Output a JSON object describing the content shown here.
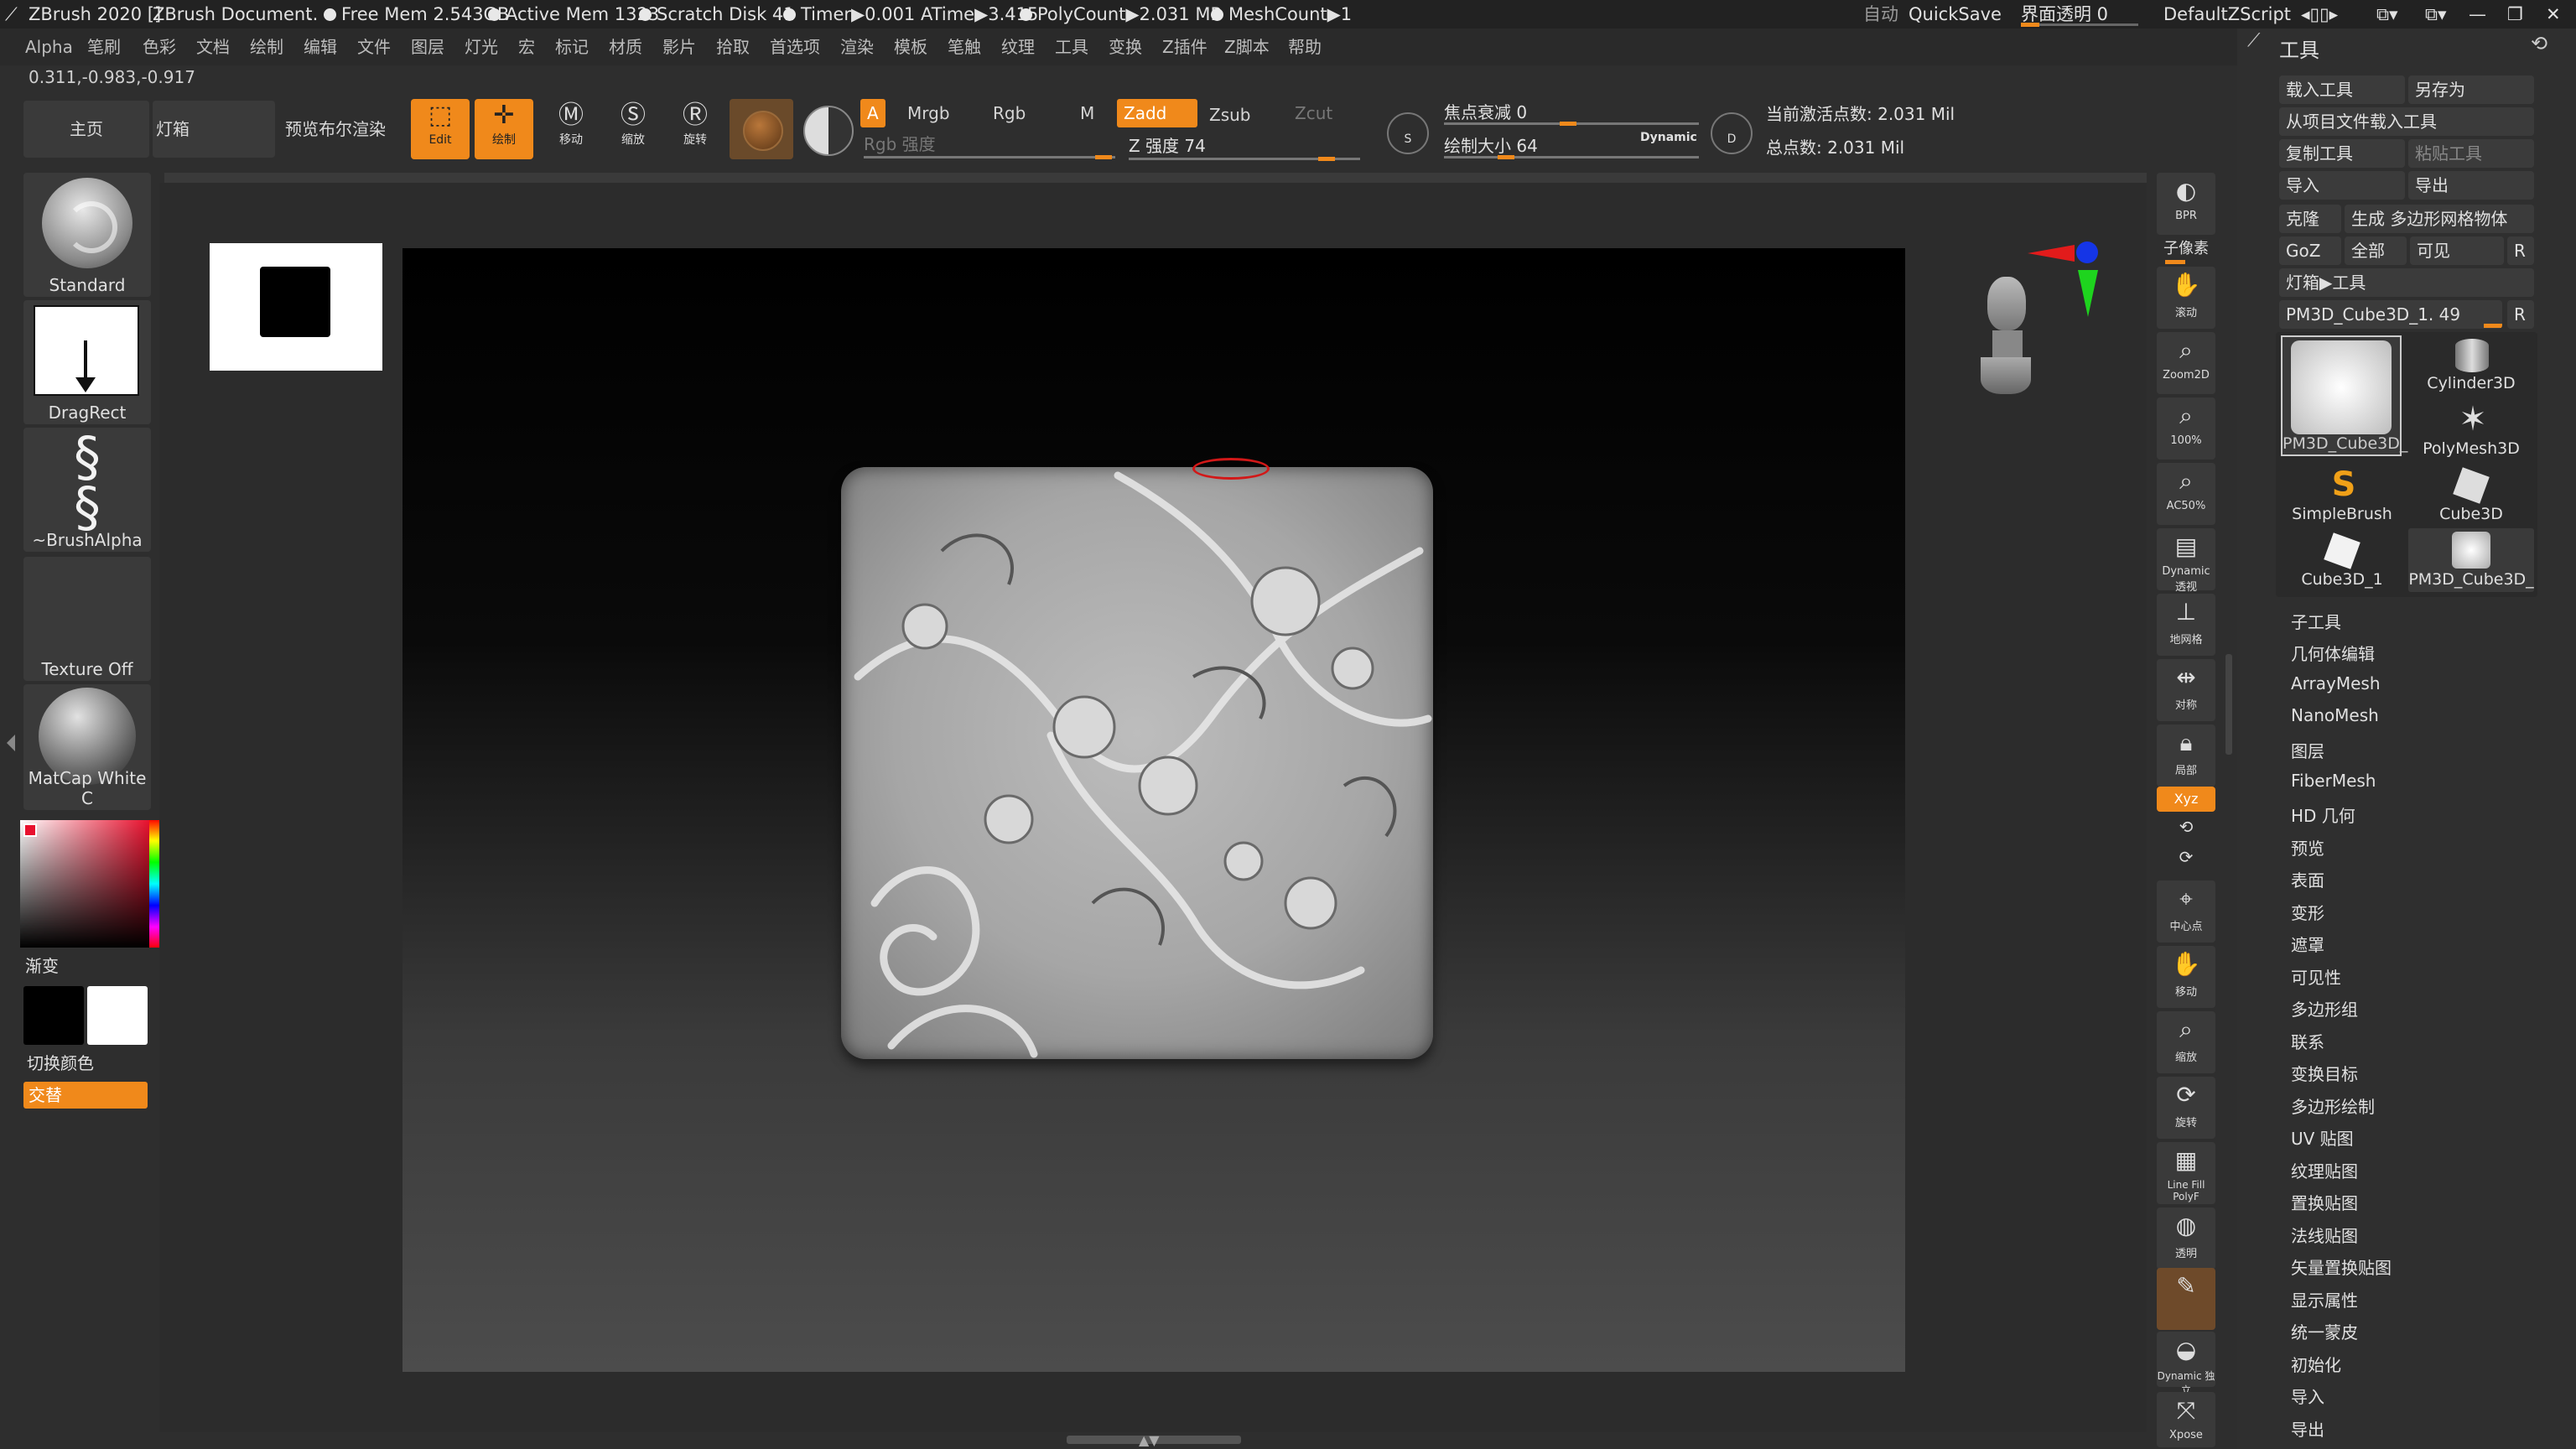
{
  "titlebar": {
    "app": "ZBrush 2020 []",
    "document": "ZBrush Document",
    "free_mem": "Free Mem 2.543GB",
    "active_mem": "Active Mem 1323",
    "scratch_disk": "Scratch Disk 41",
    "timer": "Timer▶0.001 ATime▶3.415",
    "polycount": "PolyCount▶2.031 MP",
    "meshcount": "MeshCount▶1",
    "auto": "自动",
    "quicksave": "QuickSave",
    "transparency": "界面透明 0",
    "script": "DefaultZScript"
  },
  "menubar": [
    "Alpha",
    "笔刷",
    "色彩",
    "文档",
    "绘制",
    "编辑",
    "文件",
    "图层",
    "灯光",
    "宏",
    "标记",
    "材质",
    "影片",
    "拾取",
    "首选项",
    "渲染",
    "模板",
    "笔触",
    "纹理",
    "工具",
    "变换",
    "Z插件",
    "Z脚本",
    "帮助"
  ],
  "coords": "0.311,-0.983,-0.917",
  "shelf": {
    "home": "主页",
    "lightbox": "灯箱",
    "bpr_preview": "预览布尔渲染",
    "edit": "Edit",
    "draw": "绘制",
    "move": "移动",
    "scale": "缩放",
    "rotate": "旋转"
  },
  "draw_modes": {
    "a": "A",
    "mrgb": "Mrgb",
    "rgb": "Rgb",
    "m": "M",
    "zadd": "Zadd",
    "zsub": "Zsub",
    "zcut": "Zcut",
    "rgb_intensity": "Rgb 强度",
    "z_intensity": "Z 强度 74",
    "focal_shift": "焦点衰减 0",
    "draw_size": "绘制大小 64",
    "dynamic": "Dynamic",
    "active_points": "当前激活点数: 2.031 Mil",
    "total_points": "总点数: 2.031 Mil"
  },
  "left_panel": {
    "brush": "Standard",
    "stroke": "DragRect",
    "alpha": "~BrushAlpha",
    "texture": "Texture Off",
    "material": "MatCap White C",
    "gradient": "渐变",
    "switch_color": "切换颜色",
    "alternate": "交替"
  },
  "right_strip": [
    "BPR",
    "子像素",
    "滚动",
    "Zoom2D",
    "100%",
    "AC50%",
    "Dynamic 透视",
    "地网格",
    "对称",
    "局部",
    "Xyz",
    "中心点",
    "移动",
    "缩放",
    "旋转",
    "Line Fill PolyF",
    "透明",
    "Dynamic 独立",
    "Xpose"
  ],
  "tool_panel": {
    "title": "工具",
    "load": "载入工具",
    "save_as": "另存为",
    "load_from_project": "从项目文件载入工具",
    "copy": "复制工具",
    "paste": "粘贴工具",
    "import": "导入",
    "export": "导出",
    "clone": "克隆",
    "make_polymesh": "生成 多边形网格物体",
    "goz": "GoZ",
    "all": "全部",
    "visible": "可见",
    "r": "R",
    "lightbox_tools": "灯箱▶工具",
    "current_tool": "PM3D_Cube3D_1. 49",
    "thumbs": [
      "PM3D_Cube3D_",
      "Cylinder3D",
      "PolyMesh3D",
      "SimpleBrush",
      "Cube3D",
      "Cube3D_1",
      "PM3D_Cube3D_"
    ],
    "subpalettes": [
      "子工具",
      "几何体编辑",
      "ArrayMesh",
      "NanoMesh",
      "图层",
      "FiberMesh",
      "HD 几何",
      "预览",
      "表面",
      "变形",
      "遮罩",
      "可见性",
      "多边形组",
      "联系",
      "变换目标",
      "多边形绘制",
      "UV 贴图",
      "纹理贴图",
      "置换贴图",
      "法线贴图",
      "矢量置换贴图",
      "显示属性",
      "统一蒙皮",
      "初始化",
      "导入",
      "导出"
    ]
  },
  "colors": {
    "accent": "#f0891b"
  }
}
